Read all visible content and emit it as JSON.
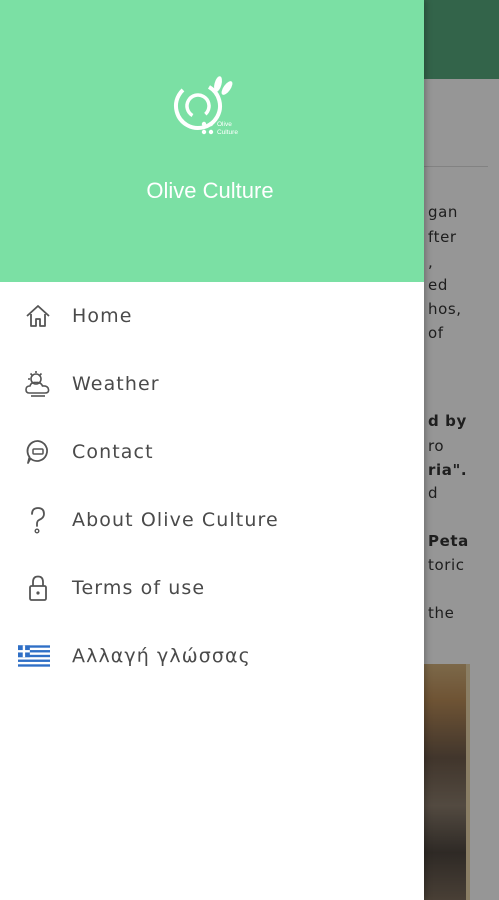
{
  "background": {
    "text_fragments": [
      {
        "text": "gan",
        "bold": false
      },
      {
        "text": "fter",
        "bold": false
      },
      {
        "text": ",",
        "bold": false
      },
      {
        "text": "ed",
        "bold": false
      },
      {
        "text": "hos,",
        "bold": false
      },
      {
        "text": "of",
        "bold": false
      },
      {
        "text": "d by",
        "bold": true
      },
      {
        "text": "ro",
        "bold": false
      },
      {
        "text": "ria\".",
        "bold": true
      },
      {
        "text": "d",
        "bold": false
      },
      {
        "text": "Peta",
        "bold": true
      },
      {
        "text": "toric",
        "bold": false
      },
      {
        "text": "the",
        "bold": false
      }
    ]
  },
  "drawer": {
    "brand": "Olive Culture",
    "logo_small_text": [
      "Olive",
      "Culture"
    ],
    "items": [
      {
        "label": "Home",
        "icon": "home-icon"
      },
      {
        "label": "Weather",
        "icon": "weather-icon"
      },
      {
        "label": "Contact",
        "icon": "chat-bubble-icon"
      },
      {
        "label": "About Olive Culture",
        "icon": "question-mark-icon"
      },
      {
        "label": "Terms of use",
        "icon": "lock-icon"
      },
      {
        "label": "Αλλαγή γλώσσας",
        "icon": "greek-flag-icon"
      }
    ]
  },
  "colors": {
    "header_green": "#7be0a4",
    "appbar_green": "#55a77c",
    "text_gray": "#4a4a4a",
    "flag_blue": "#2f6fc6"
  }
}
